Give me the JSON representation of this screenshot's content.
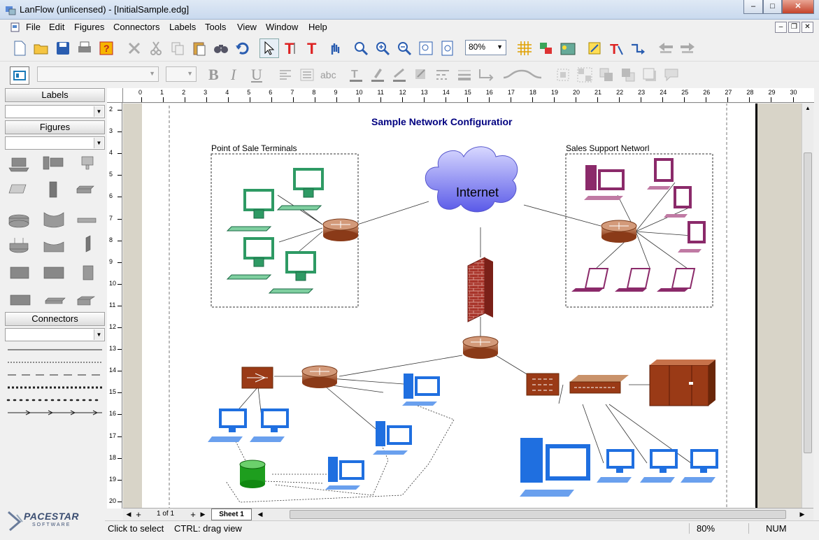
{
  "window": {
    "title": "LanFlow (unlicensed) - [InitialSample.edg]"
  },
  "menu": [
    "File",
    "Edit",
    "Figures",
    "Connectors",
    "Labels",
    "Tools",
    "View",
    "Window",
    "Help"
  ],
  "toolbar": {
    "zoom_value": "80%"
  },
  "format_toolbar": {
    "abc_label": "abc",
    "bold": "B",
    "italic": "I",
    "underline": "U"
  },
  "panels": {
    "labels": "Labels",
    "figures": "Figures",
    "connectors": "Connectors"
  },
  "brand": {
    "name": "PACESTAR",
    "sub": "SOFTWARE"
  },
  "ruler": {
    "top": [
      "0",
      "1",
      "2",
      "3",
      "4",
      "5",
      "6",
      "7",
      "8",
      "9",
      "10",
      "11",
      "12",
      "13",
      "14",
      "15",
      "16",
      "17",
      "18",
      "19",
      "20",
      "21",
      "22",
      "23",
      "24",
      "25",
      "26",
      "27",
      "28",
      "29",
      "30"
    ],
    "left": [
      "2",
      "3",
      "4",
      "5",
      "6",
      "7",
      "8",
      "9",
      "10",
      "11",
      "12",
      "13",
      "14",
      "15",
      "16",
      "17",
      "18",
      "19",
      "20"
    ]
  },
  "diagram": {
    "title": "Sample Network Configuratior",
    "group_left": "Point of Sale Terminals",
    "group_right": "Sales Support Networl",
    "cloud": "Internet"
  },
  "sheets": {
    "pager": "1 of 1",
    "tab": "Sheet 1"
  },
  "status": {
    "left": "Click to select",
    "hint": "CTRL: drag view",
    "zoom": "80%",
    "num": "NUM"
  },
  "colors": {
    "green": "#2e8b57",
    "magenta": "#8b2a6a",
    "blue": "#1f6fe0",
    "router": "#a0522d",
    "navy": "#000080"
  }
}
